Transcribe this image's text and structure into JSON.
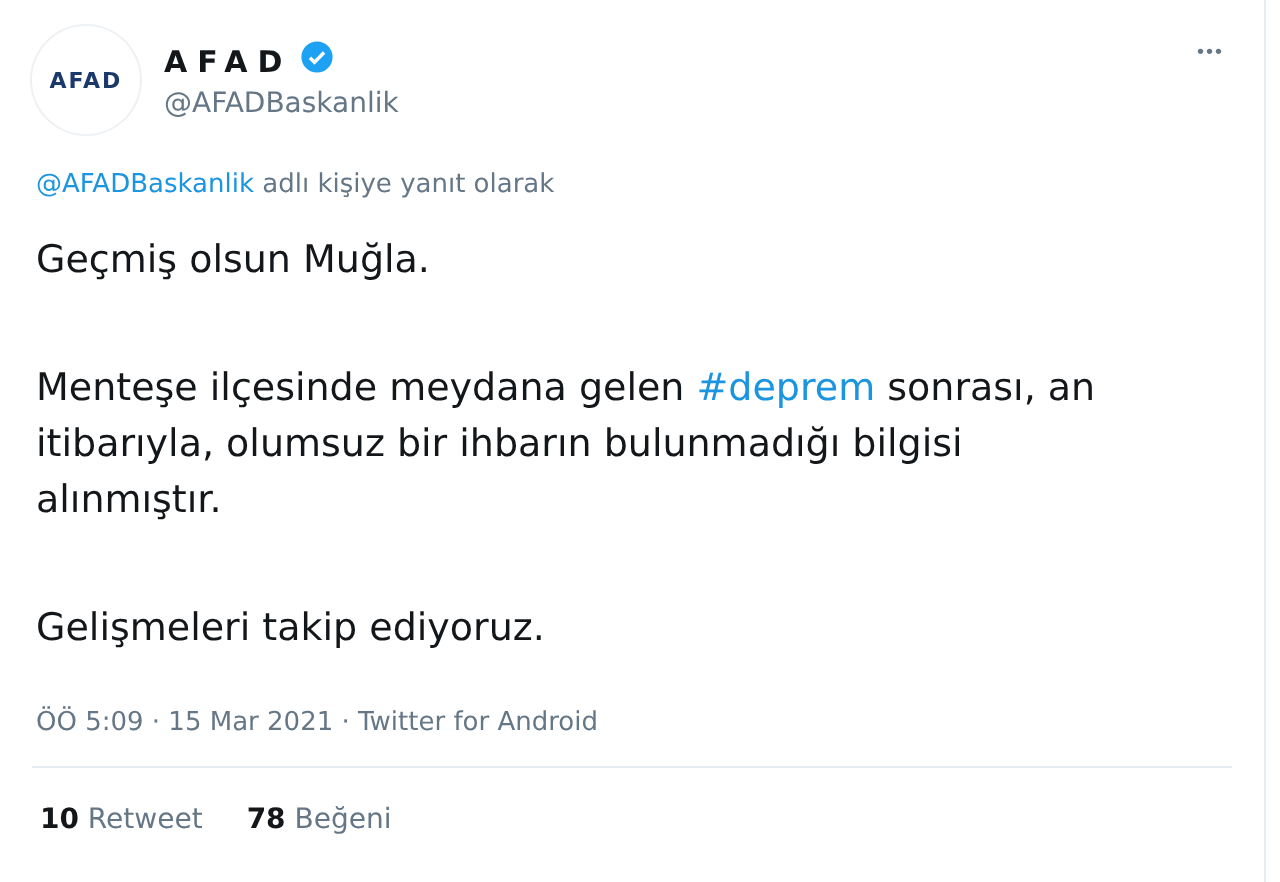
{
  "author": {
    "avatar_text": "AFAD",
    "name": "AFAD",
    "verified": true,
    "handle": "@AFADBaskanlik"
  },
  "more_button": "•••",
  "reply_context": {
    "mention": "@AFADBaskanlik",
    "text": "adlı kişiye yanıt olarak"
  },
  "paragraphs": [
    [
      {
        "kind": "text",
        "text": "Geçmiş olsun Muğla."
      }
    ],
    [
      {
        "kind": "text",
        "text": "Menteşe ilçesinde meydana gelen "
      },
      {
        "kind": "hashtag",
        "text": "#deprem"
      },
      {
        "kind": "text",
        "text": " sonrası, an itibarıyla, olumsuz bir ihbarın bulunmadığı bilgisi alınmıştır."
      }
    ],
    [
      {
        "kind": "text",
        "text": "Gelişmeleri takip ediyoruz."
      }
    ]
  ],
  "meta": {
    "text": "ÖÖ 5:09 · 15 Mar 2021 · Twitter for Android"
  },
  "stats": [
    {
      "count": "10",
      "label": "Retweet"
    },
    {
      "count": "78",
      "label": "Beğeni"
    }
  ]
}
